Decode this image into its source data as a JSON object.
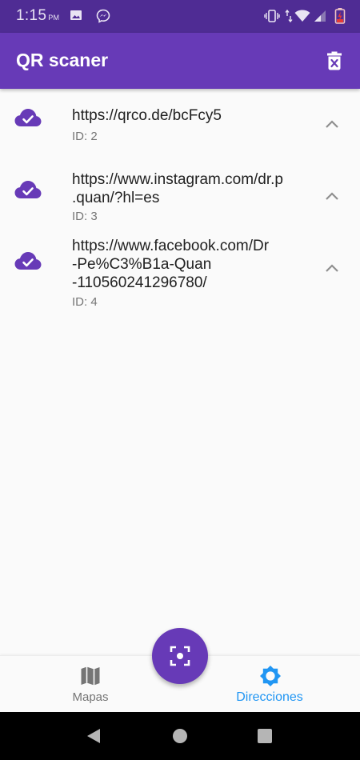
{
  "status_bar": {
    "time": "1:15",
    "ampm": "PM",
    "icons": [
      "image-icon",
      "messenger-icon",
      "vibrate-icon",
      "data-arrows-icon",
      "wifi-icon",
      "signal-icon",
      "battery-charging-icon"
    ]
  },
  "app_bar": {
    "title": "QR scaner",
    "action_icon": "delete-all-icon"
  },
  "colors": {
    "primary": "#673ab7",
    "status_bar": "#4f2c94",
    "active_nav": "#2196f3",
    "inactive_nav": "#757575"
  },
  "scans": [
    {
      "icon": "cloud-check-icon",
      "url": "https://qrco.de/bcFcy5",
      "id": "ID: 2",
      "trailing_icon": "chevron-up-icon"
    },
    {
      "icon": "cloud-check-icon",
      "url": "https://www.instagram.com/dr.p\n.quan/?hl=es",
      "id": "ID: 3",
      "trailing_icon": "chevron-up-icon"
    },
    {
      "icon": "cloud-check-icon",
      "url": "https://www.facebook.com/Dr\n-Pe%C3%B1a-Quan\n-110560241296780/",
      "id": "ID: 4",
      "trailing_icon": "chevron-up-icon"
    }
  ],
  "bottom_nav": {
    "items": [
      {
        "label": "Mapas",
        "icon": "map-icon",
        "active": false
      },
      {
        "label": "Direcciones",
        "icon": "brightness-icon",
        "active": true
      }
    ]
  },
  "fab": {
    "icon": "qr-scan-icon"
  },
  "system_nav": {
    "buttons": [
      "back-icon",
      "home-icon",
      "recents-icon"
    ]
  }
}
